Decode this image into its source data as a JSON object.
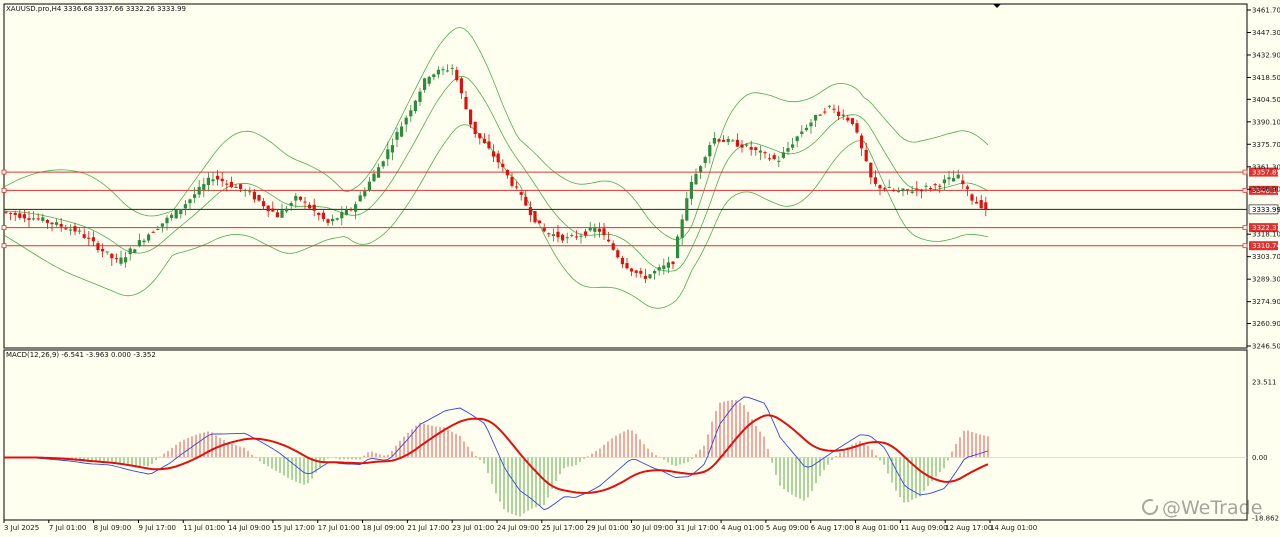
{
  "header": {
    "symbol_info": "XAUUSD.pro,H4  3336.68 3337.66 3332.26 3333.99",
    "macd_info": "MACD(12,26,9) -6.541 -3.963 0.000 -3.352"
  },
  "watermark": {
    "text": "@WeTrade",
    "icon": "bitten-circle-logo-icon"
  },
  "colors": {
    "background": "#fffff0",
    "bull": "#2e8b3e",
    "bear": "#e01010",
    "bands": "#4caf50",
    "level_line": "#e03030",
    "current_line": "#222222",
    "macd_line": "#3344dd",
    "signal_line": "#e01010",
    "hist_pos": "#e05050",
    "hist_neg": "#5aa84a"
  },
  "chart_data": {
    "type": "candlestick",
    "symbol": "XAUUSD.pro",
    "timeframe": "H4",
    "ohlc_last": {
      "open": 3336.68,
      "high": 3337.66,
      "low": 3332.26,
      "close": 3333.99
    },
    "price_axis": {
      "ticks": [
        "3461.70",
        "3447.30",
        "3432.90",
        "3418.50",
        "3404.50",
        "3390.10",
        "3375.70",
        "3361.30",
        "3346.90",
        "3318.10",
        "3303.70",
        "3289.30",
        "3274.90",
        "3260.90",
        "3246.50"
      ],
      "ylim": [
        3246.5,
        3461.7
      ]
    },
    "levels": [
      {
        "label": "3357.89",
        "value": 3357.89
      },
      {
        "label": "3346.19",
        "value": 3346.19
      },
      {
        "label": "3333.99",
        "value": 3333.99,
        "current": true
      },
      {
        "label": "3322.31",
        "value": 3322.31
      },
      {
        "label": "3310.74",
        "value": 3310.74
      }
    ],
    "x_labels": [
      "3 Jul 2025",
      "7 Jul 01:00",
      "8 Jul 09:00",
      "9 Jul 17:00",
      "11 Jul 01:00",
      "14 Jul 09:00",
      "15 Jul 17:00",
      "17 Jul 01:00",
      "18 Jul 09:00",
      "21 Jul 17:00",
      "23 Jul 01:00",
      "24 Jul 09:00",
      "25 Jul 17:00",
      "29 Jul 01:00",
      "30 Jul 09:00",
      "31 Jul 17:00",
      "4 Aug 01:00",
      "5 Aug 09:00",
      "6 Aug 17:00",
      "8 Aug 01:00",
      "11 Aug 09:00",
      "12 Aug 17:00",
      "14 Aug 01:00"
    ],
    "macd": {
      "params": "12,26,9",
      "values": {
        "macd": -6.541,
        "signal": -3.963,
        "osma_zero": 0.0,
        "histogram": -3.352
      },
      "axis": {
        "ticks": [
          "23.511",
          "0.00",
          "-18.862"
        ],
        "ylim": [
          -18.862,
          23.511
        ]
      }
    }
  }
}
